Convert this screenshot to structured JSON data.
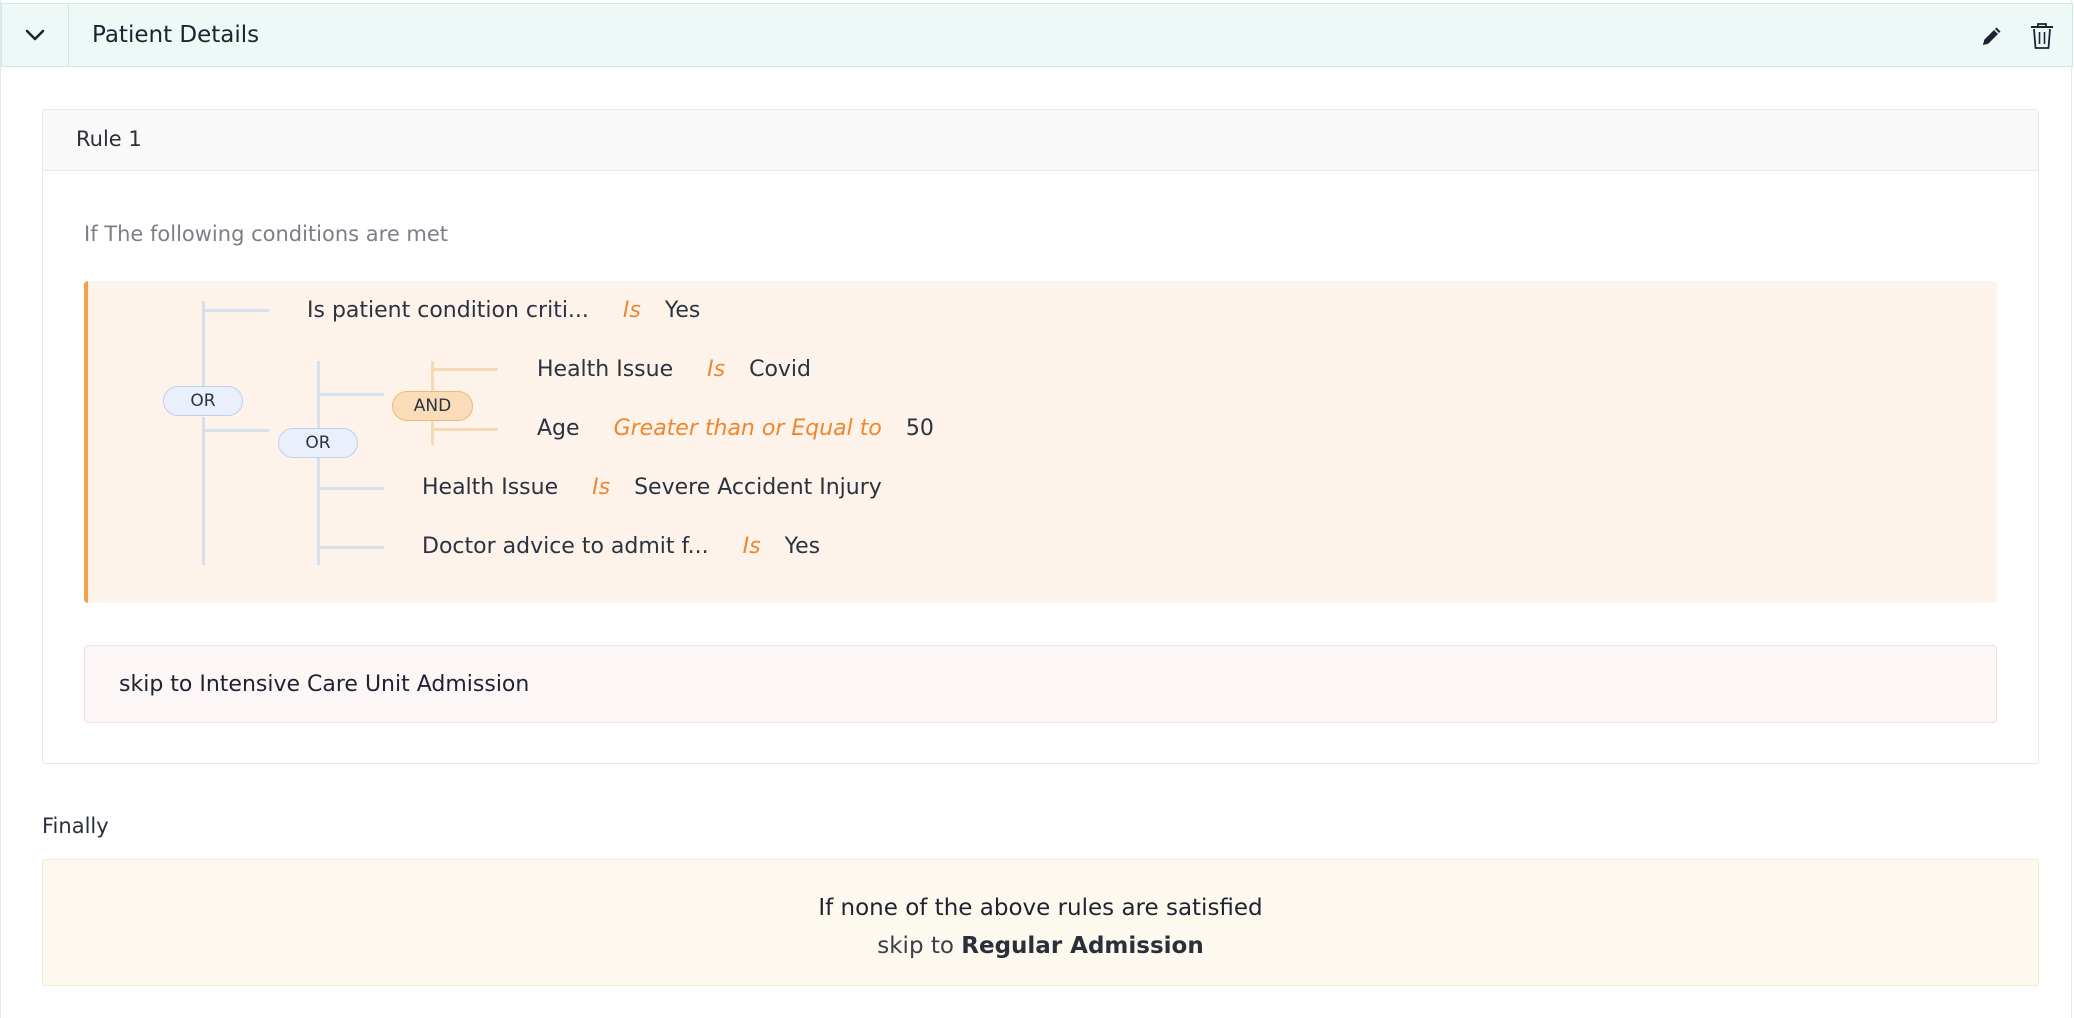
{
  "header": {
    "title": "Patient Details",
    "collapse_icon": "chevron-down-icon",
    "edit_icon": "pencil-icon",
    "delete_icon": "trash-icon"
  },
  "rule": {
    "title": "Rule 1",
    "intro": "If The following conditions are met",
    "groups": {
      "outer_operator": "OR",
      "inner_operator": "OR",
      "nested_operator": "AND"
    },
    "conditions": [
      {
        "field": "Is patient condition criti...",
        "operator": "Is",
        "value": "Yes"
      },
      {
        "field": "Health Issue",
        "operator": "Is",
        "value": "Covid"
      },
      {
        "field": "Age",
        "operator": "Greater than or Equal to",
        "value": "50"
      },
      {
        "field": "Health Issue",
        "operator": "Is",
        "value": "Severe Accident Injury"
      },
      {
        "field": "Doctor advice to admit f...",
        "operator": "Is",
        "value": "Yes"
      }
    ],
    "action": "skip to Intensive Care Unit Admission"
  },
  "finally": {
    "label": "Finally",
    "line1": "If none of the above rules are satisfied",
    "line2_prefix": "skip to",
    "line2_target": "Regular Admission"
  },
  "colors": {
    "header_bg": "#eef8f7",
    "condition_bg": "#fdf3ea",
    "condition_accent": "#f0a24e",
    "operator_text": "#f0862d",
    "final_bg": "#fdf9ee"
  }
}
